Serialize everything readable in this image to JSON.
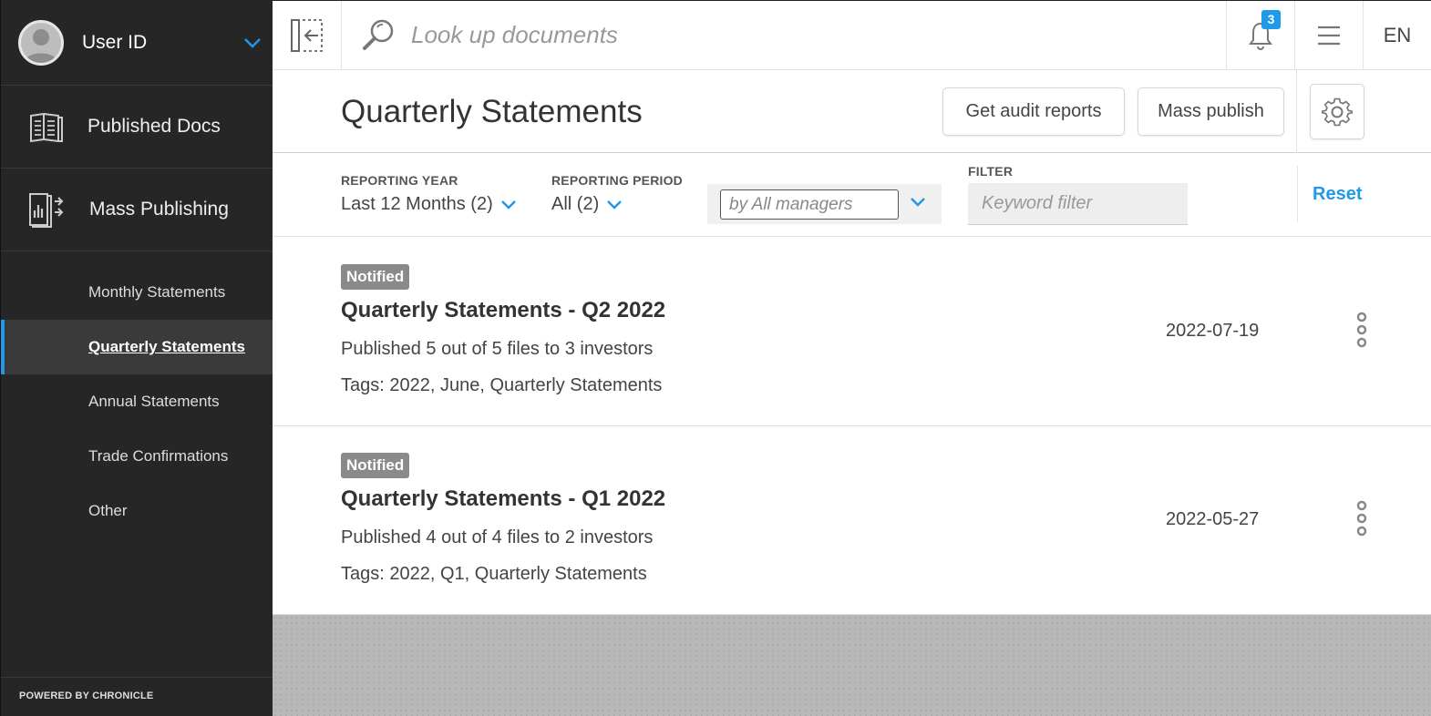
{
  "sidebar": {
    "user": {
      "name": "User ID"
    },
    "nav": [
      {
        "label": "Published Docs",
        "icon": "published-docs-icon"
      },
      {
        "label": "Mass Publishing",
        "icon": "mass-publishing-icon"
      }
    ],
    "sub_items": [
      {
        "label": "Monthly Statements",
        "active": false
      },
      {
        "label": "Quarterly Statements",
        "active": true
      },
      {
        "label": "Annual Statements",
        "active": false
      },
      {
        "label": "Trade Confirmations",
        "active": false
      },
      {
        "label": "Other",
        "active": false
      }
    ],
    "footer": "POWERED BY CHRONICLE"
  },
  "topbar": {
    "search_placeholder": "Look up documents",
    "notifications_count": "3",
    "language": "EN"
  },
  "header": {
    "title": "Quarterly Statements",
    "audit_button": "Get audit reports",
    "mass_publish_button": "Mass publish"
  },
  "filters": {
    "year_label": "REPORTING YEAR",
    "year_value": "Last 12 Months (2)",
    "period_label": "REPORTING PERIOD",
    "period_value": "All (2)",
    "manager_placeholder": "by All managers",
    "filter_label": "FILTER",
    "keyword_placeholder": "Keyword filter",
    "reset": "Reset"
  },
  "documents": [
    {
      "status": "Notified",
      "title": "Quarterly Statements - Q2 2022",
      "summary": "Published 5 out of 5 files to 3 investors",
      "tags": "Tags: 2022, June, Quarterly Statements",
      "date": "2022-07-19"
    },
    {
      "status": "Notified",
      "title": "Quarterly Statements - Q1 2022",
      "summary": "Published 4 out of 4 files to 2 investors",
      "tags": "Tags: 2022, Q1, Quarterly Statements",
      "date": "2022-05-27"
    }
  ],
  "colors": {
    "accent": "#1e9ae8",
    "sidebar_bg": "#262626",
    "tag_bg": "#8a8a8a"
  }
}
